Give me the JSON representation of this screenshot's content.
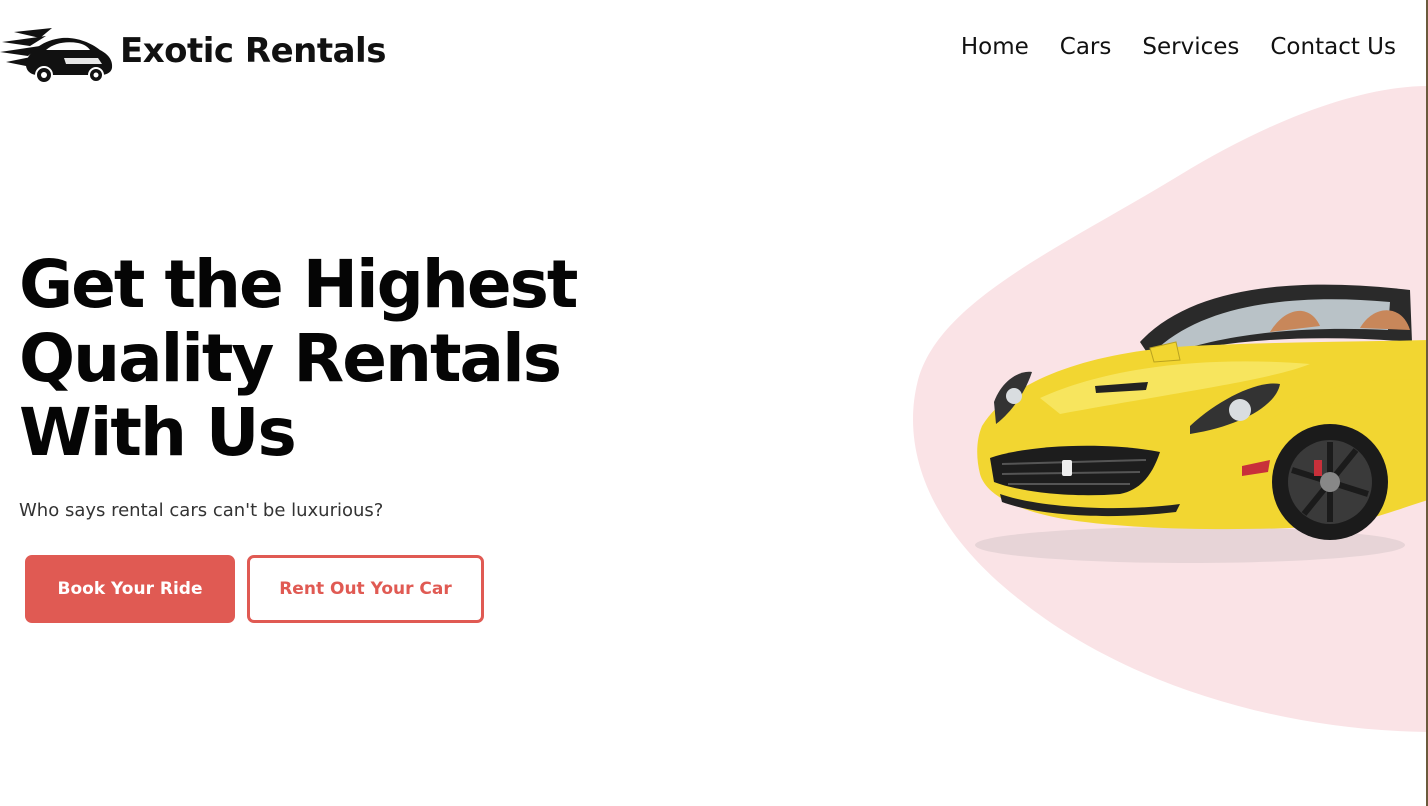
{
  "brand": {
    "name": "Exotic Rentals",
    "logo_icon": "sports-car-speed-icon"
  },
  "nav": {
    "items": [
      {
        "label": "Home"
      },
      {
        "label": "Cars"
      },
      {
        "label": "Services"
      },
      {
        "label": "Contact Us"
      }
    ]
  },
  "hero": {
    "headline_lines": [
      "Get the Highest",
      "Quality Rentals",
      "With Us"
    ],
    "subtitle": "Who says rental cars can't be luxurious?",
    "primary_button": "Book Your Ride",
    "secondary_button": "Rent Out Your Car",
    "image": "yellow-convertible-sports-car"
  },
  "colors": {
    "accent": "#e05a53",
    "blob": "#fae3e6",
    "car_body": "#f2d631",
    "text": "#111111"
  }
}
